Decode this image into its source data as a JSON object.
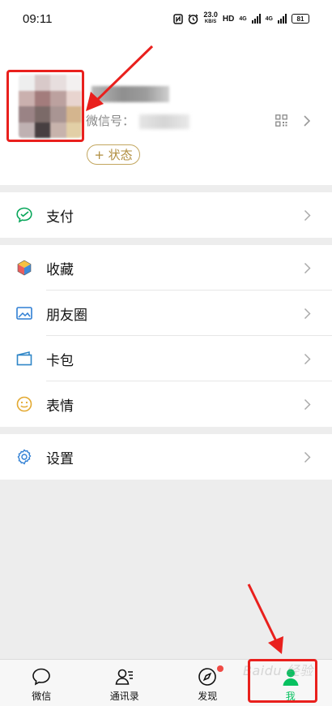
{
  "status_bar": {
    "time": "09:11",
    "speed": "23.0",
    "speed_unit": "KB/S",
    "hd": "HD",
    "net1": "4G",
    "net2": "4G",
    "battery": "81"
  },
  "profile": {
    "wechat_id_label": "微信号：",
    "status_button": "+ 状态"
  },
  "menu": [
    {
      "key": "pay",
      "label": "支付",
      "icon": "wechat-pay-icon"
    },
    {
      "key": "favorites",
      "label": "收藏",
      "icon": "favorites-cube-icon"
    },
    {
      "key": "moments",
      "label": "朋友圈",
      "icon": "moments-image-icon"
    },
    {
      "key": "cards",
      "label": "卡包",
      "icon": "card-wallet-icon"
    },
    {
      "key": "stickers",
      "label": "表情",
      "icon": "smiley-icon"
    },
    {
      "key": "settings",
      "label": "设置",
      "icon": "gear-icon"
    }
  ],
  "tabs": [
    {
      "label": "微信",
      "icon": "chat-bubble-icon"
    },
    {
      "label": "通讯录",
      "icon": "contacts-icon"
    },
    {
      "label": "发现",
      "icon": "compass-icon"
    },
    {
      "label": "我",
      "icon": "person-icon",
      "active": true
    }
  ],
  "watermark": "Baidu 经验",
  "colors": {
    "accent": "#07c160",
    "annotation": "#e9201d",
    "status_border": "#c2a65f",
    "badge": "#f04a45"
  }
}
